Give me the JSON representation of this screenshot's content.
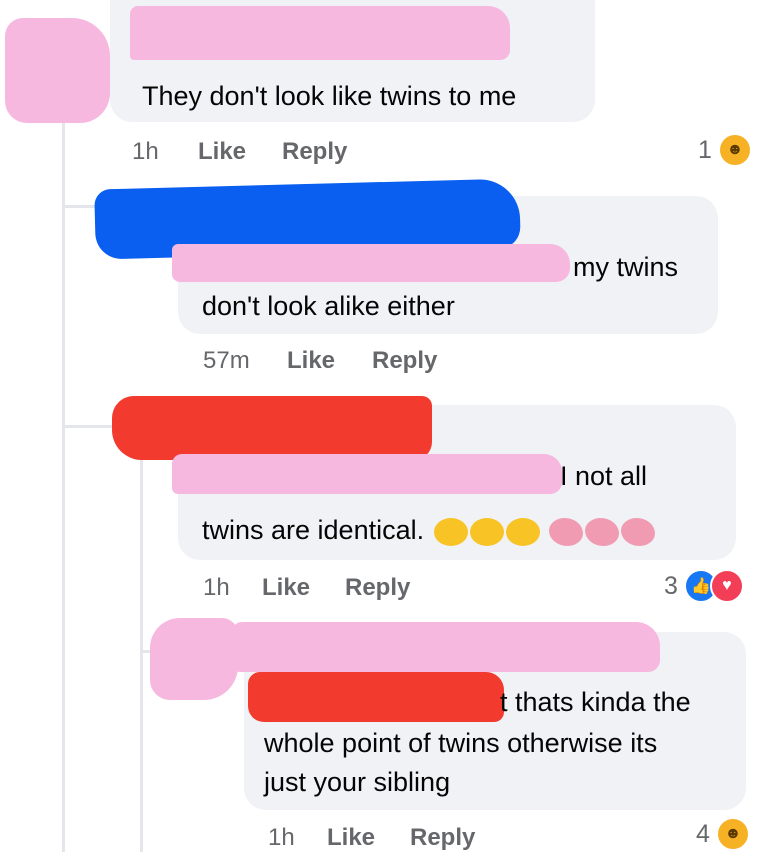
{
  "comments": [
    {
      "text_lines": [
        "They don't look like twins to me"
      ],
      "time": "1h",
      "like_label": "Like",
      "reply_label": "Reply",
      "reaction_count": "1",
      "reaction_icons": [
        "haha-icon"
      ]
    },
    {
      "text_lines": [
        "my twins",
        "don't look alike either"
      ],
      "time": "57m",
      "like_label": "Like",
      "reply_label": "Reply"
    },
    {
      "text_lines": [
        "I not all",
        "twins are identical."
      ],
      "emoji_after_text": [
        "tears-of-joy-emoji",
        "tears-of-joy-emoji",
        "tears-of-joy-emoji",
        "brain-emoji",
        "brain-emoji",
        "brain-emoji"
      ],
      "time": "1h",
      "like_label": "Like",
      "reply_label": "Reply",
      "reaction_count": "3",
      "reaction_icons": [
        "like-icon",
        "love-icon"
      ]
    },
    {
      "text_lines": [
        "t thats kinda the",
        "whole point of twins otherwise its",
        "just your sibling"
      ],
      "time": "1h",
      "like_label": "Like",
      "reply_label": "Reply",
      "reaction_count": "4",
      "reaction_icons": [
        "haha-icon"
      ]
    }
  ],
  "colors": {
    "bubble": "#f0f2f5",
    "meta_text": "#65676b",
    "redaction_pink": "#f7b8e0",
    "redaction_blue": "#0a5ef0",
    "redaction_red": "#f23a2e"
  }
}
